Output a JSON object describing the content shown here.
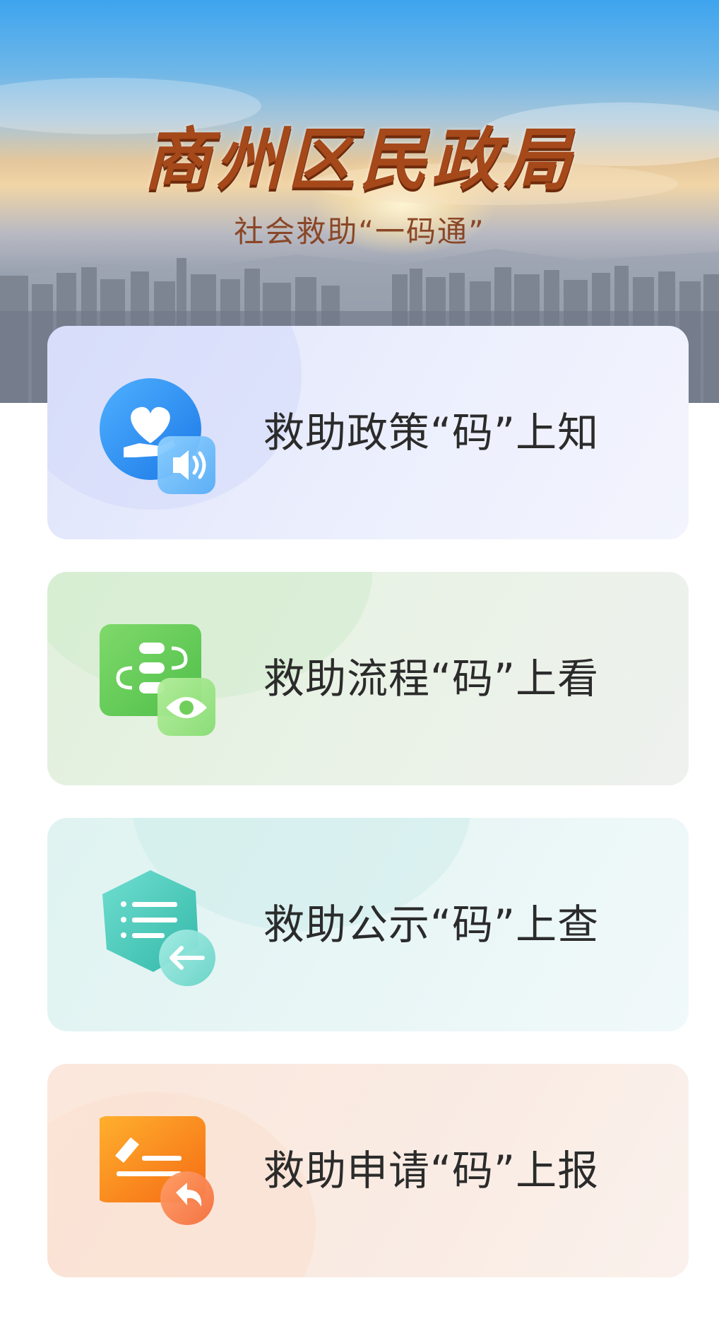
{
  "header": {
    "title": "商州区民政局",
    "subtitle": "社会救助“一码通”"
  },
  "cards": [
    {
      "label": "救助政策“码”上知",
      "icon": "heart-hand-speaker-icon",
      "accent": "#2d8ff0"
    },
    {
      "label": "救助流程“码”上看",
      "icon": "flow-eye-icon",
      "accent": "#6fcf5a"
    },
    {
      "label": "救助公示“码”上查",
      "icon": "list-return-icon",
      "accent": "#4ccbb9"
    },
    {
      "label": "救助申请“码”上报",
      "icon": "edit-reply-icon",
      "accent": "#f58a1f"
    }
  ]
}
